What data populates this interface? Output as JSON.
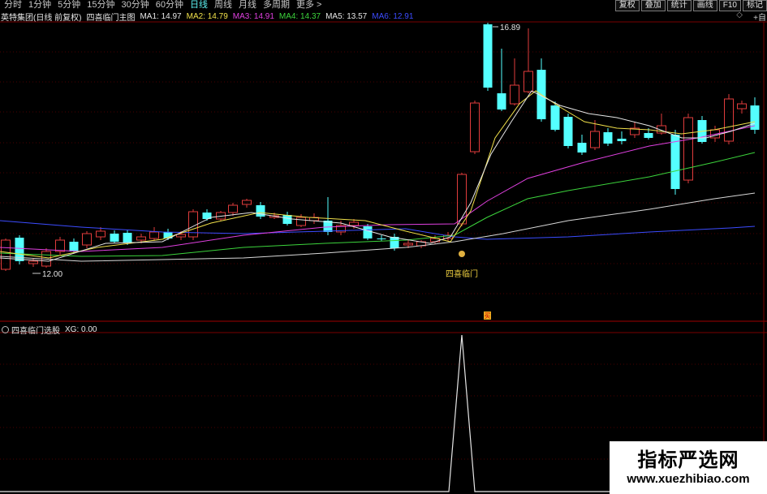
{
  "toolbar": {
    "periods": [
      {
        "label": "分时",
        "active": false
      },
      {
        "label": "1分钟",
        "active": false
      },
      {
        "label": "5分钟",
        "active": false
      },
      {
        "label": "15分钟",
        "active": false
      },
      {
        "label": "30分钟",
        "active": false
      },
      {
        "label": "60分钟",
        "active": false
      },
      {
        "label": "日线",
        "active": true
      },
      {
        "label": "周线",
        "active": false
      },
      {
        "label": "月线",
        "active": false
      },
      {
        "label": "多周期",
        "active": false
      },
      {
        "label": "更多 >",
        "active": false
      }
    ],
    "tools": [
      "复权",
      "叠加",
      "统计",
      "画线",
      "F10",
      "标记"
    ]
  },
  "main_pane": {
    "stock_label": "英特集团(日线 前复权)",
    "indicator_label": "四喜临门主图",
    "ma_values": [
      {
        "label": "MA1: 14.97",
        "color": "#e6e6e6"
      },
      {
        "label": "MA2: 14.79",
        "color": "#f0e04a"
      },
      {
        "label": "MA3: 14.91",
        "color": "#e040e0"
      },
      {
        "label": "MA4: 14.37",
        "color": "#3cd43c"
      },
      {
        "label": "MA5: 13.57",
        "color": "#e6e6e6"
      },
      {
        "label": "MA6: 12.91",
        "color": "#3c4cff"
      }
    ],
    "corner_label": "+自",
    "high_label": "16.89",
    "low_label": "12.00",
    "signal_label": "四喜临门",
    "buy_badge": "买",
    "signal_icon": "money-bag-icon"
  },
  "sub_pane": {
    "title": "四喜临门选股",
    "value": "XG: 0.00"
  },
  "watermark": {
    "title": "指标严选网",
    "url": "www.xuezhibiao.com"
  },
  "colors": {
    "up": "#e03c3c",
    "down": "#54ffff",
    "grid": "#7a0000",
    "background": "#000000"
  }
}
